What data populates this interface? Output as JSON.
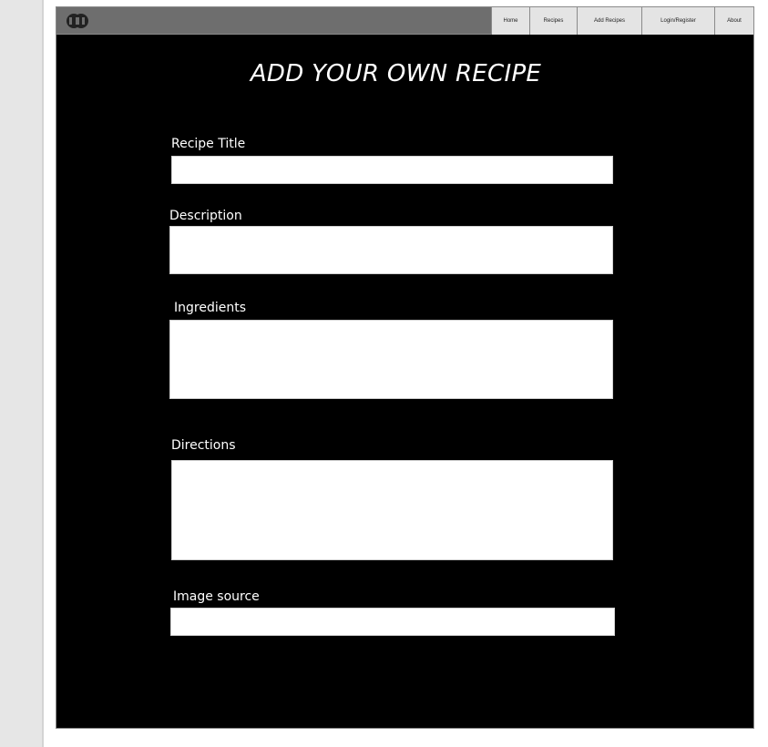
{
  "nav": {
    "items": [
      {
        "label": "Home"
      },
      {
        "label": "Recipes"
      },
      {
        "label": "Add Recipes"
      },
      {
        "label": "Login/Register"
      },
      {
        "label": "About"
      }
    ]
  },
  "page": {
    "title": "ADD YOUR OWN RECIPE"
  },
  "form": {
    "recipe_title_label": "Recipe Title",
    "description_label": "Description",
    "ingredients_label": "Ingredients",
    "directions_label": "Directions",
    "image_source_label": "Image source"
  },
  "colors": {
    "background": "#000000",
    "topbar": "#6e6e6e",
    "nav_button": "#e4e4e4"
  }
}
